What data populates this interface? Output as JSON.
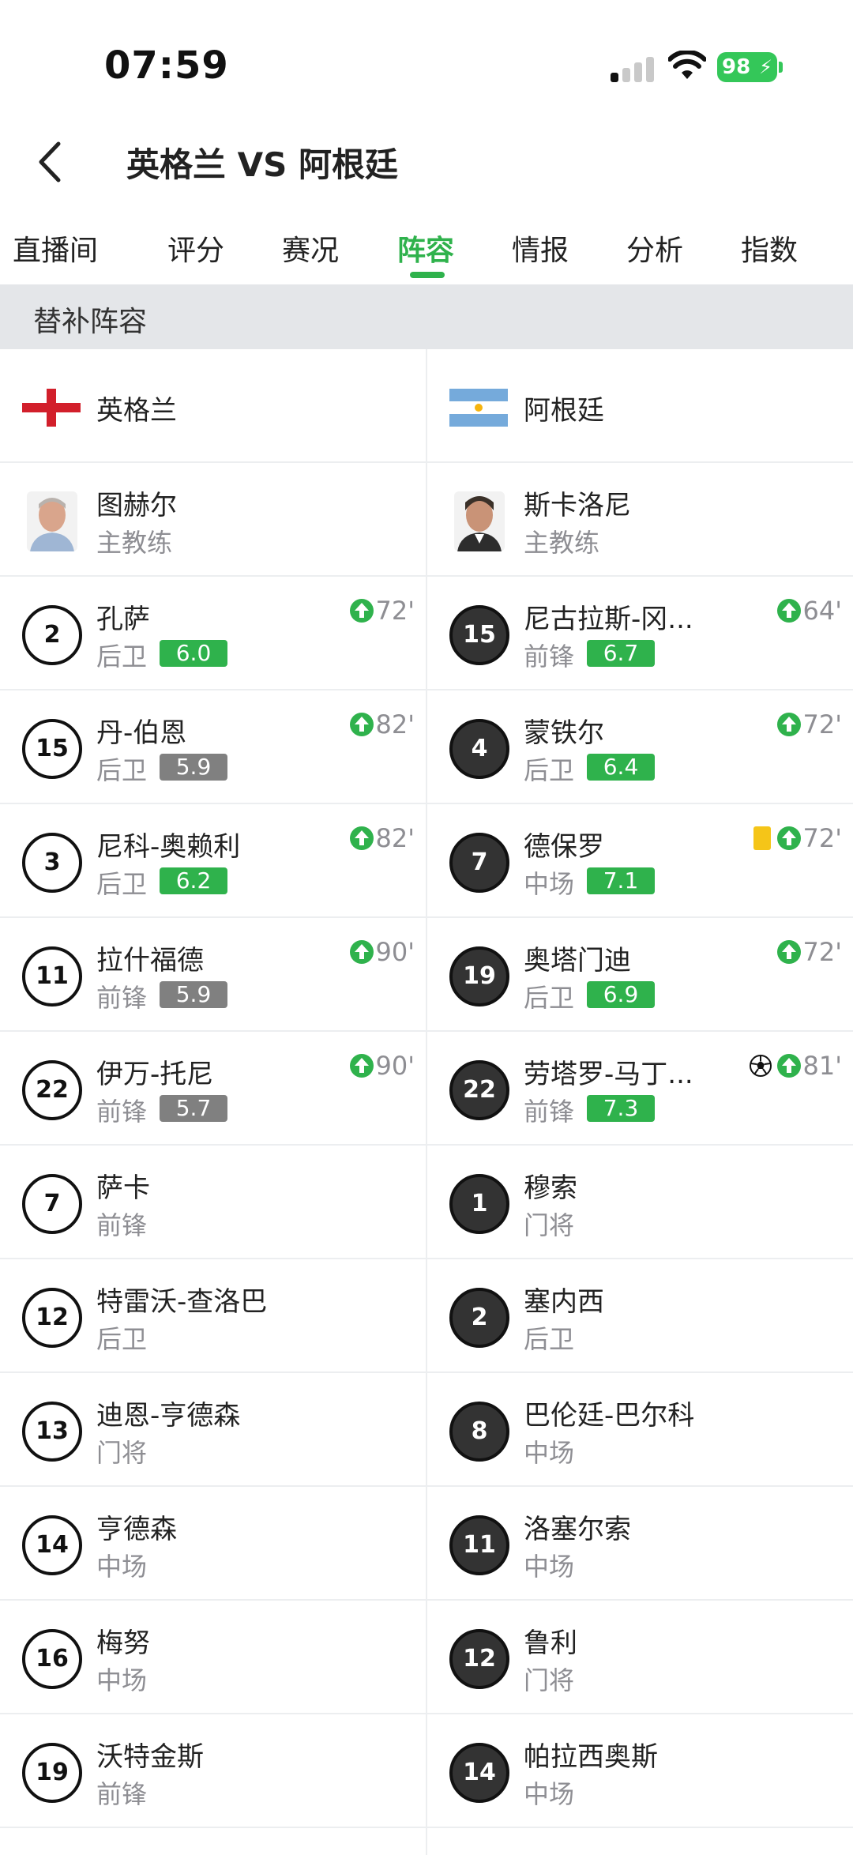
{
  "status": {
    "time": "07:59",
    "battery": "98"
  },
  "header": {
    "title": "英格兰 VS 阿根廷"
  },
  "tabs": [
    "直播间",
    "评分",
    "赛况",
    "阵容",
    "情报",
    "分析",
    "指数"
  ],
  "section": {
    "title": "替补阵容"
  },
  "teams": {
    "home": "英格兰",
    "away": "阿根廷"
  },
  "coaches": {
    "home": {
      "name": "图赫尔",
      "role": "主教练"
    },
    "away": {
      "name": "斯卡洛尼",
      "role": "主教练"
    }
  },
  "players": {
    "home": [
      {
        "num": "2",
        "name": "孔萨",
        "pos": "后卫",
        "rating": "6.0",
        "sub": "72'"
      },
      {
        "num": "15",
        "name": "丹-伯恩",
        "pos": "后卫",
        "rating": "5.9",
        "sub": "82'"
      },
      {
        "num": "3",
        "name": "尼科-奥赖利",
        "pos": "后卫",
        "rating": "6.2",
        "sub": "82'"
      },
      {
        "num": "11",
        "name": "拉什福德",
        "pos": "前锋",
        "rating": "5.9",
        "sub": "90'"
      },
      {
        "num": "22",
        "name": "伊万-托尼",
        "pos": "前锋",
        "rating": "5.7",
        "sub": "90'"
      },
      {
        "num": "7",
        "name": "萨卡",
        "pos": "前锋"
      },
      {
        "num": "12",
        "name": "特雷沃-查洛巴",
        "pos": "后卫"
      },
      {
        "num": "13",
        "name": "迪恩-亨德森",
        "pos": "门将"
      },
      {
        "num": "14",
        "name": "亨德森",
        "pos": "中场"
      },
      {
        "num": "16",
        "name": "梅努",
        "pos": "中场"
      },
      {
        "num": "19",
        "name": "沃特金斯",
        "pos": "前锋"
      }
    ],
    "away": [
      {
        "num": "15",
        "name": "尼古拉斯-冈...",
        "pos": "前锋",
        "rating": "6.7",
        "sub": "64'"
      },
      {
        "num": "4",
        "name": "蒙铁尔",
        "pos": "后卫",
        "rating": "6.4",
        "sub": "72'"
      },
      {
        "num": "7",
        "name": "德保罗",
        "pos": "中场",
        "rating": "7.1",
        "sub": "72'"
      },
      {
        "num": "19",
        "name": "奥塔门迪",
        "pos": "后卫",
        "rating": "6.9",
        "sub": "72'"
      },
      {
        "num": "22",
        "name": "劳塔罗-马丁...",
        "pos": "前锋",
        "rating": "7.3",
        "sub": "81'"
      },
      {
        "num": "1",
        "name": "穆索",
        "pos": "门将"
      },
      {
        "num": "2",
        "name": "塞内西",
        "pos": "后卫"
      },
      {
        "num": "8",
        "name": "巴伦廷-巴尔科",
        "pos": "中场"
      },
      {
        "num": "11",
        "name": "洛塞尔索",
        "pos": "中场"
      },
      {
        "num": "12",
        "name": "鲁利",
        "pos": "门将"
      },
      {
        "num": "14",
        "name": "帕拉西奥斯",
        "pos": "中场"
      }
    ]
  },
  "colors": {
    "accent": "#2fb24c",
    "grey_rating": "#808080",
    "yellow_card": "#f5c518"
  }
}
